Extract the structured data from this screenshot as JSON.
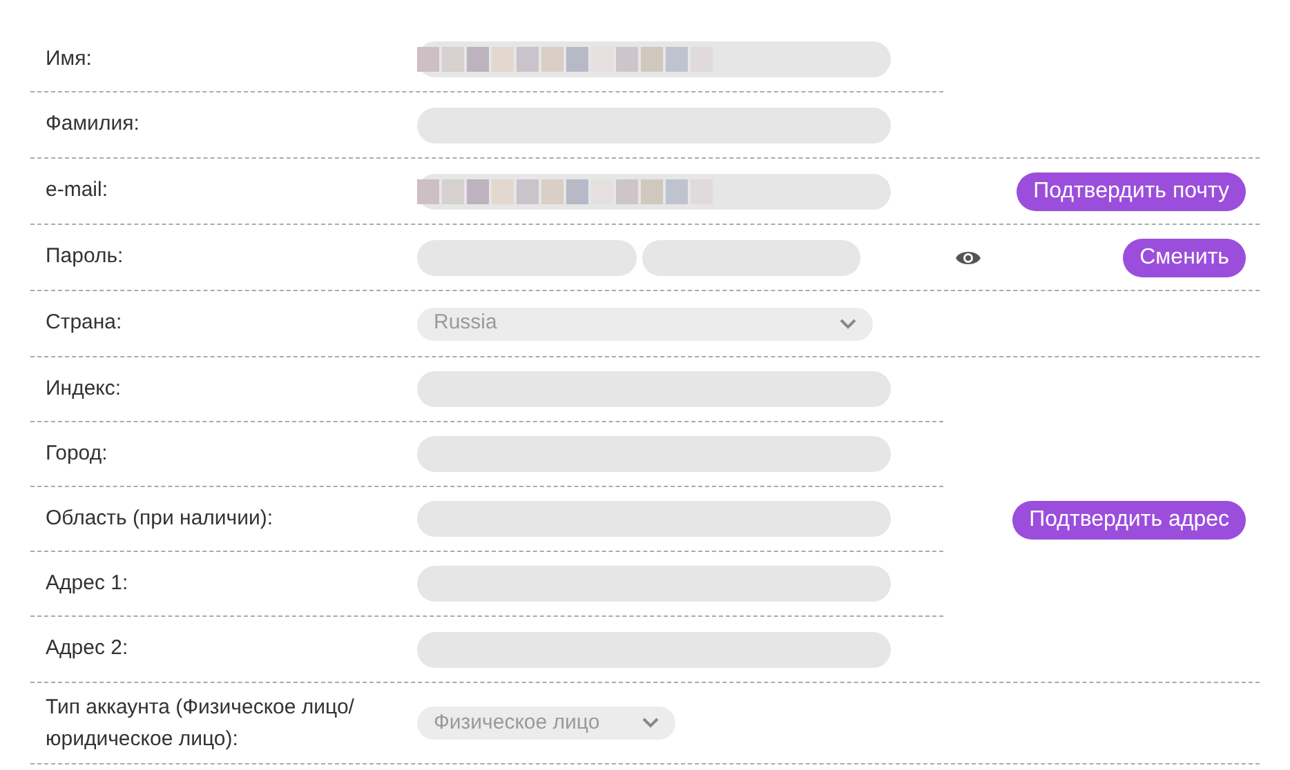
{
  "groups": [
    {
      "rows": [
        {
          "label": "Имя:",
          "kind": "blurred"
        },
        {
          "label": "Фамилия:",
          "kind": "input"
        }
      ]
    },
    {
      "rows": [
        {
          "label": "e-mail:",
          "kind": "blurred"
        }
      ],
      "button": "Подтвердить почту"
    },
    {
      "rows": [
        {
          "label": "Пароль:",
          "kind": "password"
        }
      ],
      "button": "Сменить",
      "show_password_icon": true
    },
    {
      "rows": [
        {
          "label": "Страна:",
          "kind": "select",
          "value": "Russia"
        }
      ]
    },
    {
      "rows": [
        {
          "label": "Индекс:",
          "kind": "input"
        },
        {
          "label": "Город:",
          "kind": "input"
        },
        {
          "label": "Область (при наличии):",
          "kind": "input"
        },
        {
          "label": "Адрес 1:",
          "kind": "input"
        },
        {
          "label": "Адрес 2:",
          "kind": "input"
        }
      ],
      "button": "Подтвердить адрес"
    },
    {
      "rows": [
        {
          "label": "Тип аккаунта (Физическое лицо/ юридическое лицо):",
          "kind": "select_small",
          "value": "Физическое лицо"
        }
      ]
    }
  ]
}
